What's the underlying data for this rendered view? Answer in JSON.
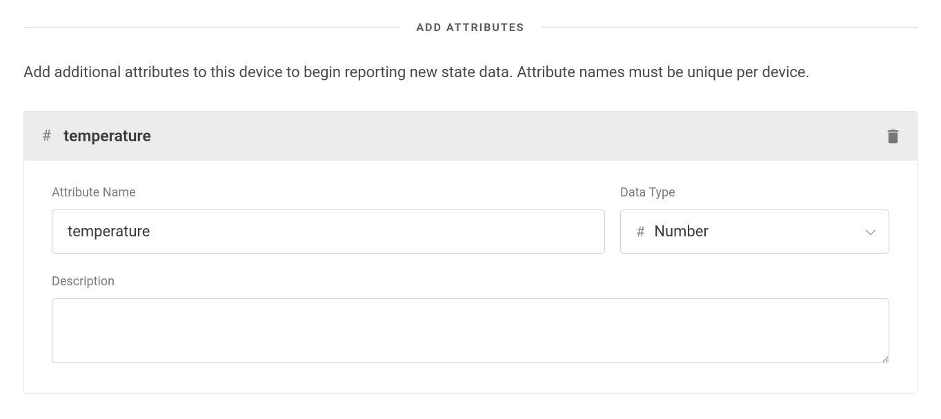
{
  "section": {
    "title": "ADD ATTRIBUTES",
    "helper": "Add additional attributes to this device to begin reporting new state data. Attribute names must be unique per device."
  },
  "attribute": {
    "header_icon": "#",
    "header_title": "temperature",
    "form": {
      "name_label": "Attribute Name",
      "name_value": "temperature",
      "datatype_label": "Data Type",
      "datatype_icon": "#",
      "datatype_value": "Number",
      "description_label": "Description",
      "description_value": ""
    }
  }
}
